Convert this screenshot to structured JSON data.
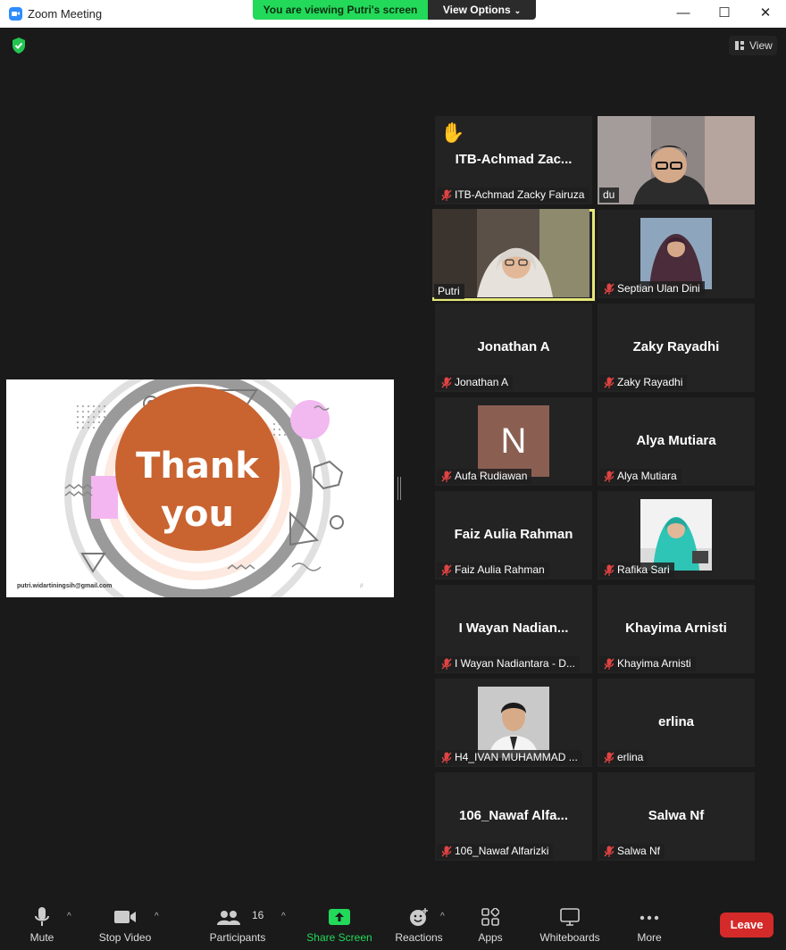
{
  "window": {
    "title": "Zoom Meeting",
    "minimize": "—",
    "maximize": "☐",
    "close": "✕"
  },
  "banner": {
    "viewing": "You are viewing Putri's screen",
    "view_options": "View Options"
  },
  "view_button": {
    "label": "View"
  },
  "shared_screen": {
    "slide_text_1": "Thank",
    "slide_text_2": "you",
    "email": "putri.widartiningsih@gmail.com"
  },
  "gallery": [
    {
      "center_name": "ITB-Achmad  Zac...",
      "label": "ITB-Achmad Zacky Fairuza",
      "muted": true,
      "hand_raised": true
    },
    {
      "center_name": "",
      "label": "du",
      "muted": false
    },
    {
      "center_name": "",
      "label": "Putri",
      "muted": false,
      "active_speaker": true
    },
    {
      "center_name": "",
      "label": "Septian Ulan Dini",
      "muted": true
    },
    {
      "center_name": "Jonathan A",
      "label": "Jonathan A",
      "muted": true
    },
    {
      "center_name": "Zaky Rayadhi",
      "label": "Zaky Rayadhi",
      "muted": true
    },
    {
      "center_name": "",
      "avatar_letter": "N",
      "label": "Aufa Rudiawan",
      "muted": true
    },
    {
      "center_name": "Alya Mutiara",
      "label": "Alya Mutiara",
      "muted": true
    },
    {
      "center_name": "Faiz Aulia Rahman",
      "label": "Faiz Aulia Rahman",
      "muted": true
    },
    {
      "center_name": "",
      "label": "Rafika Sari",
      "muted": true
    },
    {
      "center_name": "I  Wayan  Nadian...",
      "label": "I Wayan Nadiantara - D...",
      "muted": true
    },
    {
      "center_name": "Khayima Arnisti",
      "label": "Khayima Arnisti",
      "muted": true
    },
    {
      "center_name": "",
      "label": "H4_IVAN MUHAMMAD ...",
      "muted": true
    },
    {
      "center_name": "erlina",
      "label": "erlina",
      "muted": true
    },
    {
      "center_name": "106_Nawaf  Alfa...",
      "label": "106_Nawaf Alfarizki",
      "muted": true
    },
    {
      "center_name": "Salwa Nf",
      "label": "Salwa Nf",
      "muted": true
    }
  ],
  "toolbar": {
    "mute": "Mute",
    "stop_video": "Stop Video",
    "participants": "Participants",
    "participants_count": "16",
    "share_screen": "Share Screen",
    "reactions": "Reactions",
    "apps": "Apps",
    "whiteboards": "Whiteboards",
    "more": "More",
    "leave": "Leave"
  },
  "colors": {
    "share_green": "#23d959",
    "leave_red": "#d52a2a",
    "active_speaker": "#e8e87a",
    "slide_orange": "#cc6633"
  }
}
